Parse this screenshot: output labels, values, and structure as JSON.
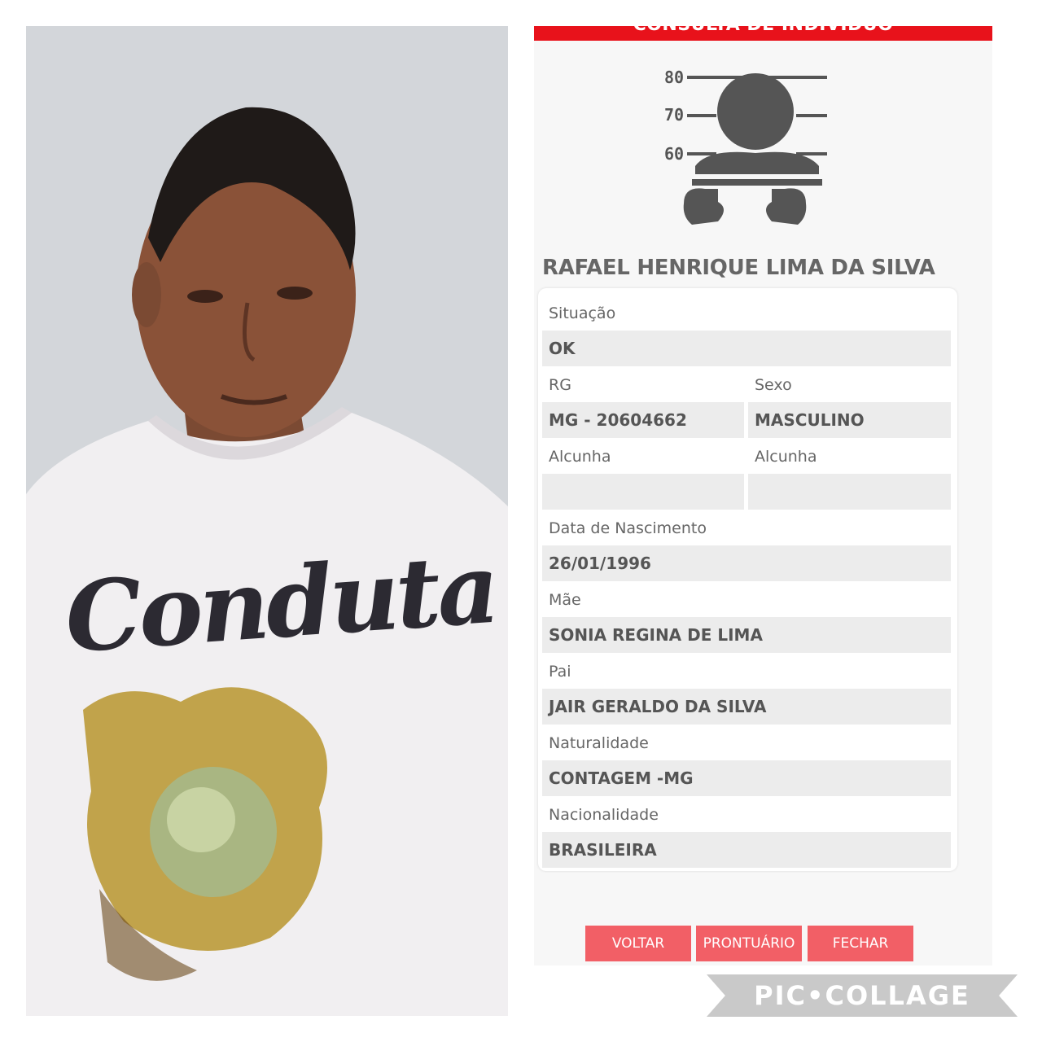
{
  "header": {
    "title": "CONSULTA DE INDIVÍDUO"
  },
  "mugshot": {
    "ruler": [
      "80",
      "70",
      "60"
    ]
  },
  "person": {
    "name": "RAFAEL HENRIQUE LIMA DA SILVA"
  },
  "fields": {
    "situacao": {
      "label": "Situação",
      "value": "OK"
    },
    "rg": {
      "label": "RG",
      "value": "MG - 20604662"
    },
    "sexo": {
      "label": "Sexo",
      "value": "MASCULINO"
    },
    "alcunha_1": {
      "label": "Alcunha",
      "value": ""
    },
    "alcunha_2": {
      "label": "Alcunha",
      "value": ""
    },
    "nascimento": {
      "label": "Data de Nascimento",
      "value": "26/01/1996"
    },
    "mae": {
      "label": "Mãe",
      "value": "SONIA REGINA DE LIMA"
    },
    "pai": {
      "label": "Pai",
      "value": "JAIR GERALDO DA SILVA"
    },
    "naturalidade": {
      "label": "Naturalidade",
      "value": "CONTAGEM -MG"
    },
    "nacionalidade": {
      "label": "Nacionalidade",
      "value": "BRASILEIRA"
    }
  },
  "buttons": {
    "back": "VOLTAR",
    "record": "PRONTUÁRIO",
    "close": "FECHAR"
  },
  "photo": {
    "shirt_text": "Conduta"
  },
  "watermark": {
    "text": "PIC•COLLAGE"
  },
  "colors": {
    "header_red": "#e8121b",
    "button_pink": "#f25f66",
    "field_gray": "#ececec"
  }
}
